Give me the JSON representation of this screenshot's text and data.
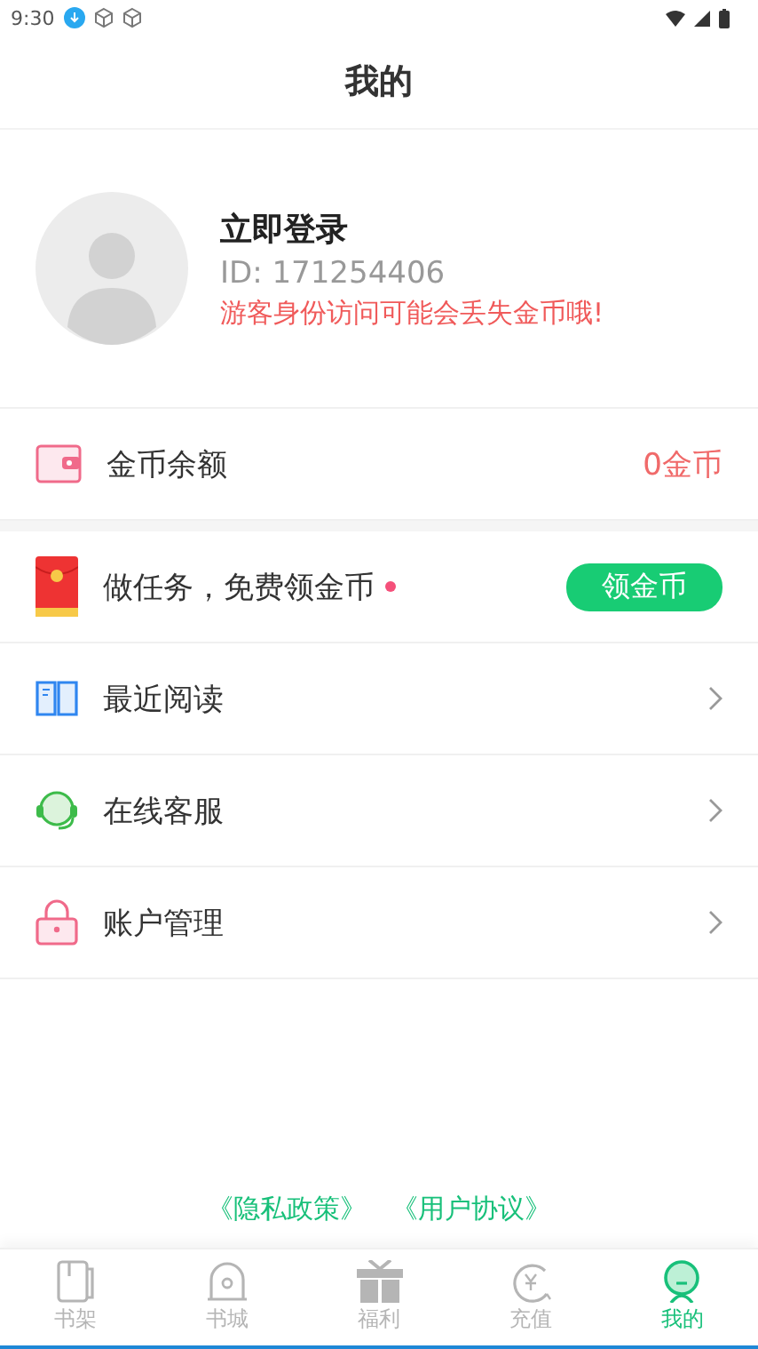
{
  "status_bar": {
    "time": "9:30"
  },
  "header": {
    "title": "我的"
  },
  "profile": {
    "name": "立即登录",
    "id": "ID: 171254406",
    "warning": "游客身份访问可能会丢失金币哦!"
  },
  "balance": {
    "label": "金币余额",
    "value": "0金币"
  },
  "task": {
    "label": "做任务，免费领金币",
    "dot": true,
    "button": "领金币"
  },
  "menu": [
    {
      "kind": "book",
      "label": "最近阅读"
    },
    {
      "kind": "headset",
      "label": "在线客服"
    },
    {
      "kind": "lock",
      "label": "账户管理"
    }
  ],
  "links": [
    "《隐私政策》",
    "《用户协议》"
  ],
  "tabs": [
    {
      "kind": "shelf",
      "label": "书架",
      "selected": false
    },
    {
      "kind": "store",
      "label": "书城",
      "selected": false
    },
    {
      "kind": "gift",
      "label": "福利",
      "selected": false
    },
    {
      "kind": "recharge",
      "label": "充值",
      "selected": false
    },
    {
      "kind": "me",
      "label": "我的",
      "selected": true
    }
  ]
}
